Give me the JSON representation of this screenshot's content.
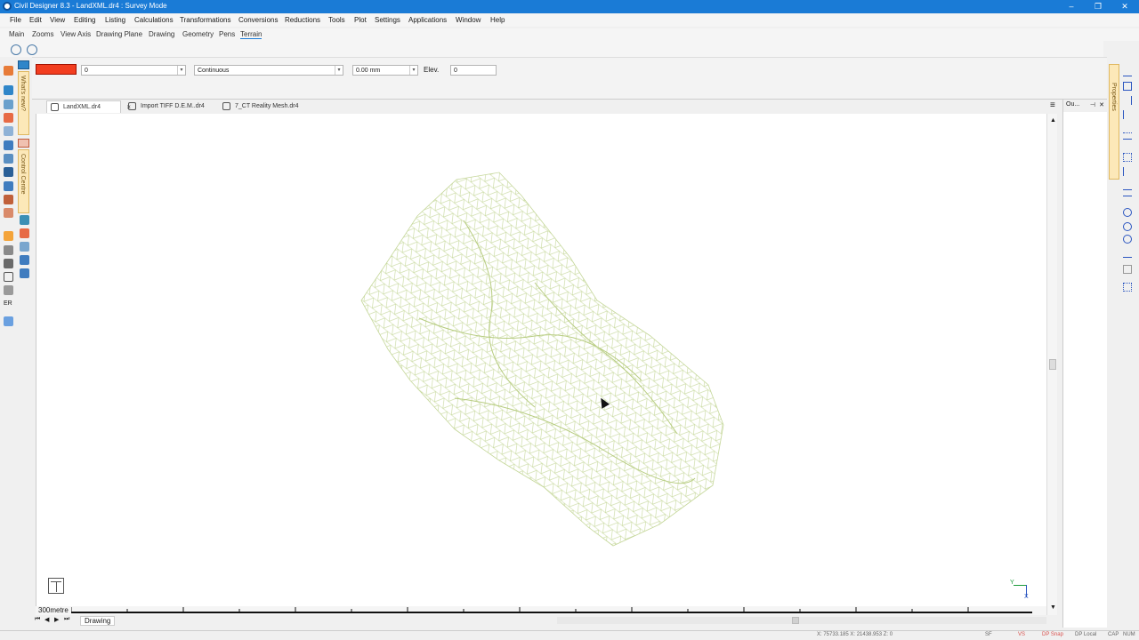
{
  "window": {
    "title": "Civil Designer 8.3 - LandXML.dr4 : Survey Mode"
  },
  "menu": [
    "File",
    "Edit",
    "View",
    "Editing",
    "Listing",
    "Calculations",
    "Transformations",
    "Conversions",
    "Reductions",
    "Tools",
    "Plot",
    "Settings",
    "Applications",
    "Window",
    "Help"
  ],
  "ribbon_tabs": [
    "Main",
    "Zooms",
    "View Axis",
    "Drawing Plane",
    "Drawing",
    "Geometry",
    "Pens",
    "Terrain"
  ],
  "active_ribbon_tab": "Terrain",
  "properties": {
    "color_hex": "#f23d1f",
    "layer_value": "0",
    "linetype_value": "Continuous",
    "lineweight_value": "0.00 mm",
    "elev_label": "Elev.",
    "elev_value": "0"
  },
  "side_tabs": {
    "whats_new": "What's new?",
    "control_centre": "Control Centre",
    "properties": "Properties"
  },
  "doc_tabs": [
    {
      "label": "LandXML.dr4",
      "active": true
    },
    {
      "label": "Import TIFF D.E.M..dr4",
      "active": false
    },
    {
      "label": "7_CT Reality Mesh.dr4",
      "active": false
    }
  ],
  "out_panel": {
    "title": "Ou..."
  },
  "scale": {
    "label": "300metre"
  },
  "bottom": {
    "sheet_tab": "Drawing"
  },
  "status": {
    "coords": "X: 75733.185 X: 21438.953 Z: 0",
    "sf": "SF",
    "vs": "VS",
    "dp_snap": "DP Snap",
    "dp_local": "DP Local",
    "cap": "CAP",
    "num": "NUM"
  },
  "axis": {
    "y": "Y",
    "x": "X"
  },
  "left_text_icon": "ER",
  "colors": {
    "mesh": "#c5d79a",
    "accent": "#1a7bd6",
    "titlebar": "#1a7bd6"
  }
}
